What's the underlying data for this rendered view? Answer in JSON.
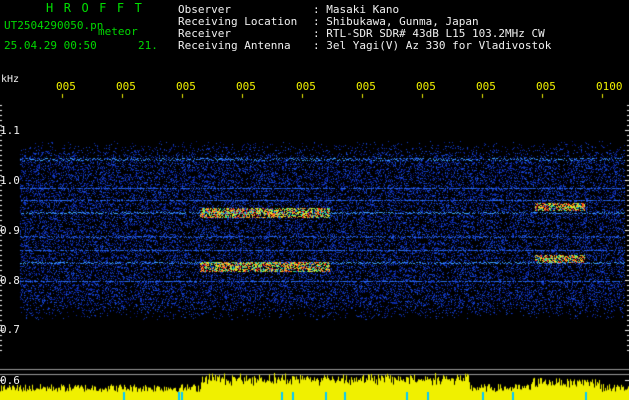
{
  "header": {
    "title": "HROFFT",
    "file_name": "UT2504290050.pn",
    "file_suffix": "meteor",
    "date_time": "25.04.29 00:50",
    "value": "21.",
    "labels": [
      "Observer",
      "Receiving Location",
      "Receiver",
      "Receiving Antenna"
    ],
    "values": [
      ": Masaki Kano",
      ": Shibukawa, Gunma, Japan",
      ": RTL-SDR SDR# 43dB L15 103.2MHz CW",
      ": 3el Yagi(V) Az 330 for Vladivostok"
    ]
  },
  "axis": {
    "unit": "kHz",
    "y_ticks": [
      "1.1",
      "1.0",
      "0.9",
      "0.8",
      "0.7",
      "0.6"
    ],
    "x_ticks": [
      "005",
      "005",
      "005",
      "005",
      "005",
      "005",
      "005",
      "005",
      "005",
      "0100"
    ]
  },
  "colors": {
    "background": "#000000",
    "title": "#00e000",
    "info_text": "#f0f0f0",
    "time_labels": "#f0f000",
    "noise_floor": "#0a1a8c",
    "signal_line": "#3da8ff",
    "hot": "#ff2020",
    "level_bars": "#f0f000"
  }
}
